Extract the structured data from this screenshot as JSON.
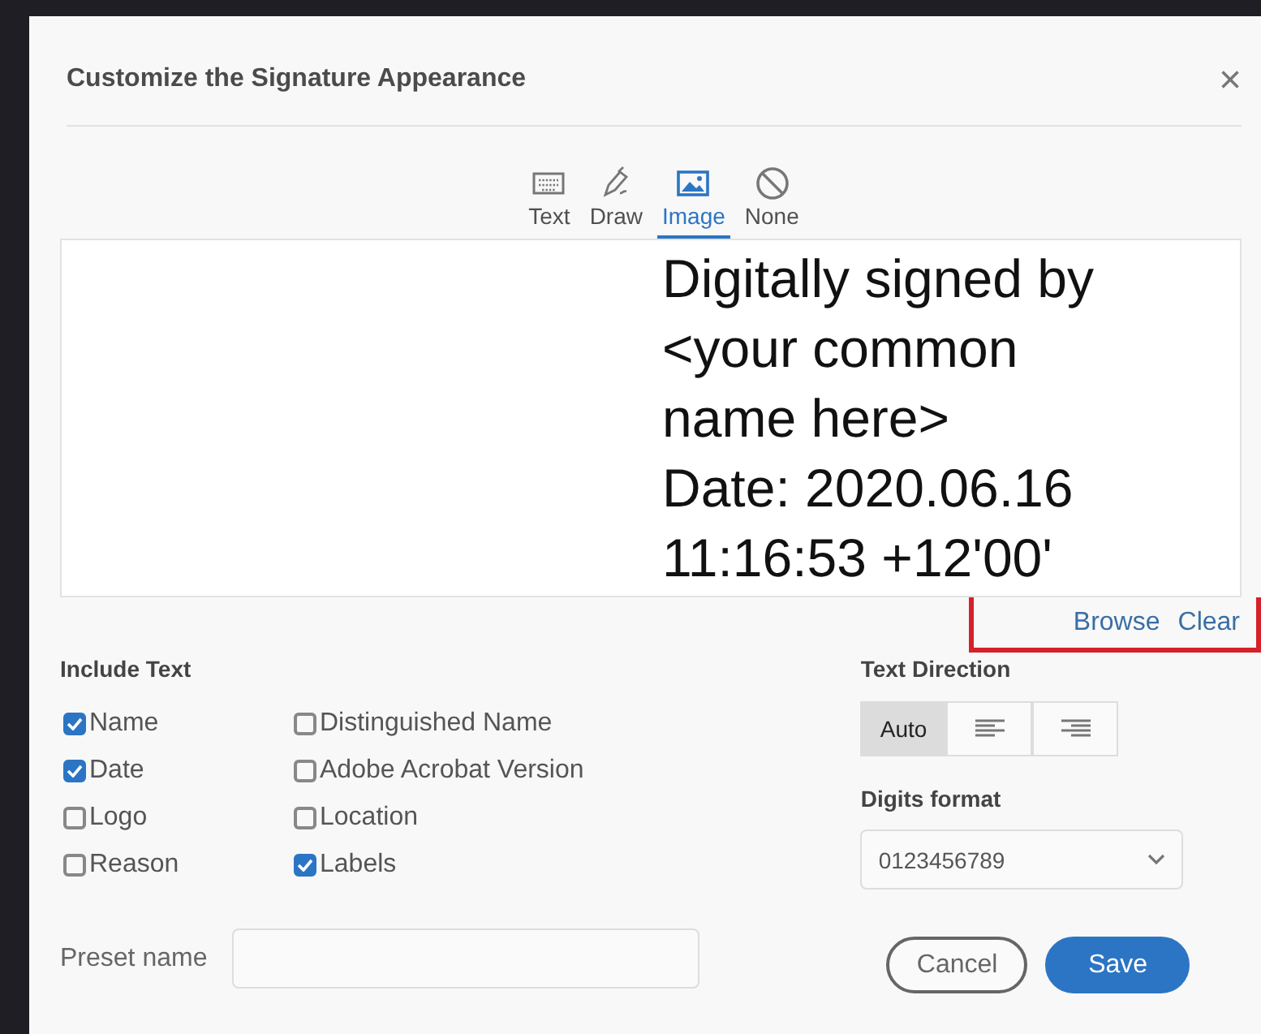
{
  "dialog": {
    "title": "Customize the Signature Appearance",
    "close": "×"
  },
  "tabs": [
    {
      "label": "Text",
      "kind": "keyboard",
      "selected": false
    },
    {
      "label": "Draw",
      "kind": "pen",
      "selected": false
    },
    {
      "label": "Image",
      "kind": "image",
      "selected": true
    },
    {
      "label": "None",
      "kind": "none",
      "selected": false
    }
  ],
  "preview": {
    "lines": [
      "Digitally signed by",
      "<your common",
      "name here>",
      "Date: 2020.06.16",
      "11:16:53 +12'00'"
    ]
  },
  "image_links": [
    "Browse",
    "Clear"
  ],
  "include_text": {
    "heading": "Include Text",
    "options": [
      {
        "label": "Name",
        "checked": true
      },
      {
        "label": "Date",
        "checked": true
      },
      {
        "label": "Logo",
        "checked": false
      },
      {
        "label": "Reason",
        "checked": false
      },
      {
        "label": "Distinguished Name",
        "checked": false
      },
      {
        "label": "Adobe Acrobat Version",
        "checked": false
      },
      {
        "label": "Location",
        "checked": false
      },
      {
        "label": "Labels",
        "checked": true
      }
    ]
  },
  "text_direction": {
    "heading": "Text Direction",
    "options": [
      {
        "kind": "auto",
        "label": "Auto",
        "selected": true
      },
      {
        "kind": "left",
        "selected": false
      },
      {
        "kind": "right",
        "selected": false
      }
    ]
  },
  "digits_format": {
    "heading": "Digits format",
    "value": "0123456789"
  },
  "preset": {
    "label": "Preset name"
  },
  "buttons": [
    {
      "label": "Cancel",
      "kind": "secondary"
    },
    {
      "label": "Save",
      "kind": "primary"
    }
  ]
}
